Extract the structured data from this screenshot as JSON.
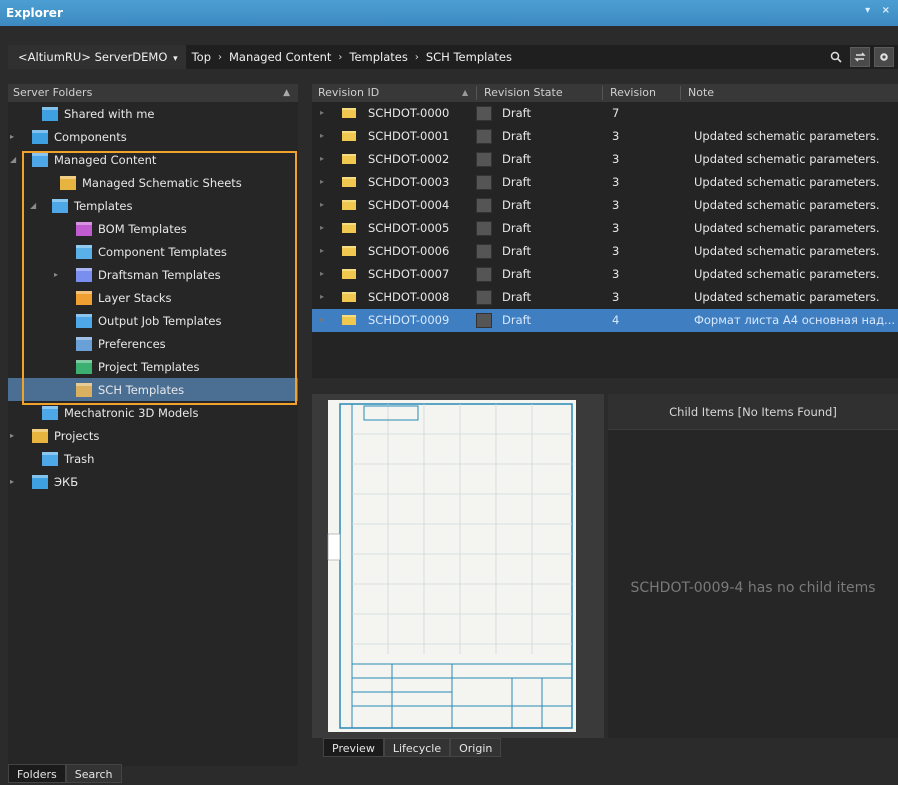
{
  "window": {
    "title": "Explorer",
    "controls": "▾ ×"
  },
  "address": {
    "server": "<AltiumRU> ServerDEMO",
    "server_arrow": "▾",
    "path": [
      "Top",
      "Managed Content",
      "Templates",
      "SCH Templates"
    ],
    "sep": "›"
  },
  "left_panel": {
    "header": "Server Folders",
    "collapse": "▲",
    "items": [
      {
        "label": "Shared with me",
        "expander": "",
        "icon": "shared-folder-icon"
      },
      {
        "label": "Components",
        "expander": "▸",
        "icon": "components-folder-icon"
      },
      {
        "label": "Managed Content",
        "expander": "◢",
        "icon": "folder-icon"
      },
      {
        "label": "Managed Schematic Sheets",
        "expander": "",
        "icon": "schematic-sheets-folder-icon"
      },
      {
        "label": "Templates",
        "expander": "◢",
        "icon": "folder-icon"
      },
      {
        "label": "BOM Templates",
        "expander": "",
        "icon": "bom-templates-folder-icon"
      },
      {
        "label": "Component Templates",
        "expander": "",
        "icon": "component-templates-folder-icon"
      },
      {
        "label": "Draftsman Templates",
        "expander": "▸",
        "icon": "draftsman-templates-folder-icon"
      },
      {
        "label": "Layer Stacks",
        "expander": "",
        "icon": "layer-stacks-folder-icon"
      },
      {
        "label": "Output Job Templates",
        "expander": "",
        "icon": "output-job-folder-icon"
      },
      {
        "label": "Preferences",
        "expander": "",
        "icon": "preferences-folder-icon"
      },
      {
        "label": "Project Templates",
        "expander": "",
        "icon": "project-templates-folder-icon"
      },
      {
        "label": "SCH Templates",
        "expander": "",
        "icon": "sch-templates-folder-icon"
      },
      {
        "label": "Mechatronic 3D Models",
        "expander": "",
        "icon": "folder-icon"
      },
      {
        "label": "Projects",
        "expander": "▸",
        "icon": "projects-folder-icon"
      },
      {
        "label": "Trash",
        "expander": "",
        "icon": "trash-folder-icon"
      },
      {
        "label": "ЭКБ",
        "expander": "▸",
        "icon": "ekb-folder-icon"
      }
    ],
    "tabs": [
      "Folders",
      "Search"
    ]
  },
  "grid": {
    "columns": [
      "Revision ID",
      "Revision State",
      "Revision",
      "Note"
    ],
    "sort_indicator": "▲",
    "rows": [
      {
        "id": "SCHDOT-0000",
        "state": "Draft",
        "rev": "7",
        "note": ""
      },
      {
        "id": "SCHDOT-0001",
        "state": "Draft",
        "rev": "3",
        "note": "Updated schematic parameters."
      },
      {
        "id": "SCHDOT-0002",
        "state": "Draft",
        "rev": "3",
        "note": "Updated schematic parameters."
      },
      {
        "id": "SCHDOT-0003",
        "state": "Draft",
        "rev": "3",
        "note": "Updated schematic parameters."
      },
      {
        "id": "SCHDOT-0004",
        "state": "Draft",
        "rev": "3",
        "note": "Updated schematic parameters."
      },
      {
        "id": "SCHDOT-0005",
        "state": "Draft",
        "rev": "3",
        "note": "Updated schematic parameters."
      },
      {
        "id": "SCHDOT-0006",
        "state": "Draft",
        "rev": "3",
        "note": "Updated schematic parameters."
      },
      {
        "id": "SCHDOT-0007",
        "state": "Draft",
        "rev": "3",
        "note": "Updated schematic parameters."
      },
      {
        "id": "SCHDOT-0008",
        "state": "Draft",
        "rev": "3",
        "note": "Updated schematic parameters."
      },
      {
        "id": "SCHDOT-0009",
        "state": "Draft",
        "rev": "4",
        "note": "Формат листа А4 основная над..."
      }
    ],
    "expander": "▸"
  },
  "preview": {
    "tabs": [
      "Preview",
      "Lifecycle",
      "Origin"
    ]
  },
  "child": {
    "header": "Child Items [No Items Found]",
    "message": "SCHDOT-0009-4 has no child items"
  },
  "colors": {
    "accent": "#3f7fc1",
    "highlight": "#f0a22c",
    "title_bar": "#4d9fd3"
  }
}
